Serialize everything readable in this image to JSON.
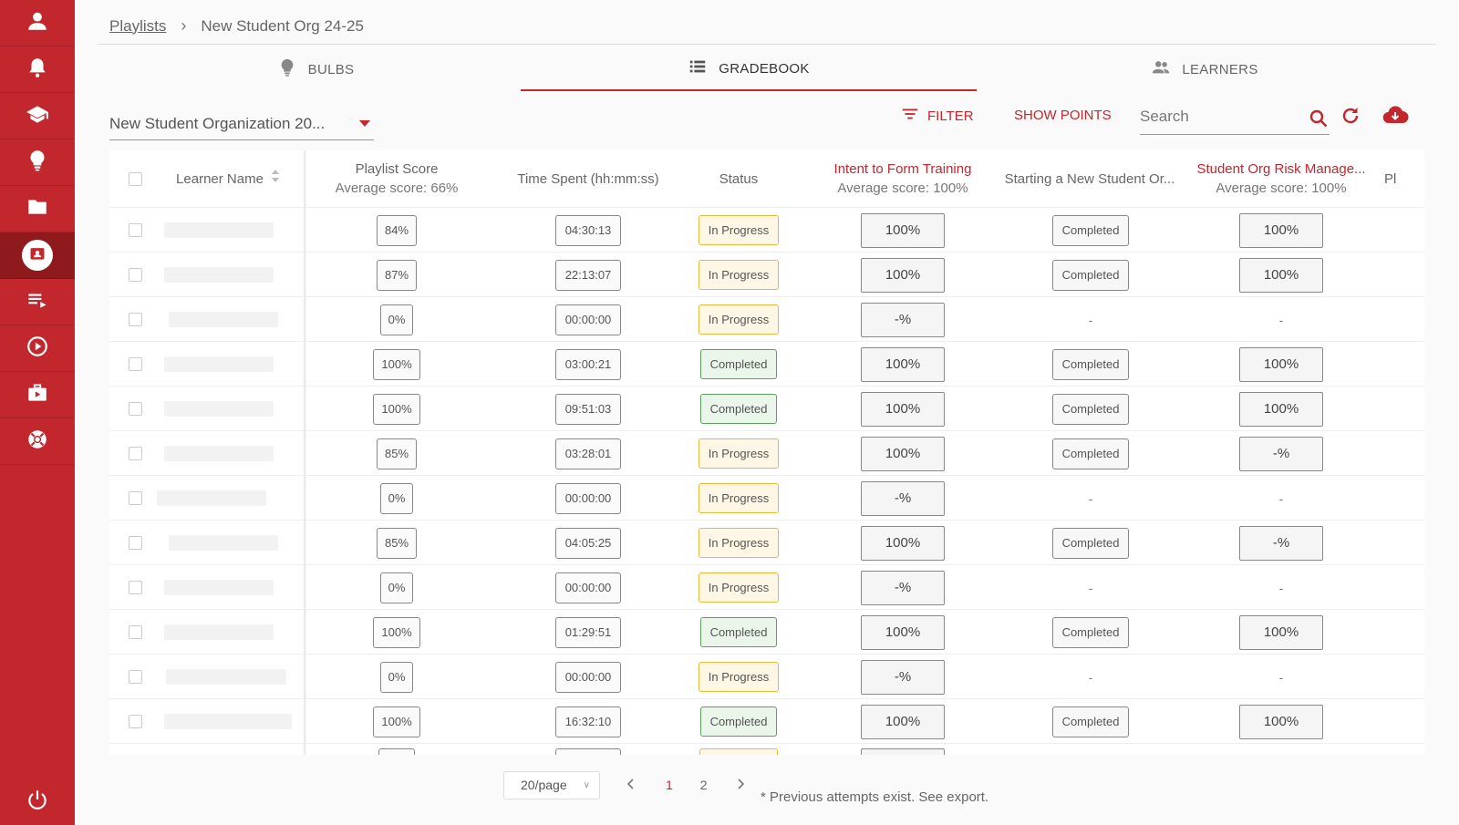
{
  "sidebar": {
    "items": [
      {
        "icon": "user-icon"
      },
      {
        "icon": "bell-icon"
      },
      {
        "icon": "graduation-cap-icon"
      },
      {
        "icon": "lightbulb-icon"
      },
      {
        "icon": "folder-icon"
      },
      {
        "icon": "gradebook-contact-icon",
        "active": true
      },
      {
        "icon": "playlist-icon"
      },
      {
        "icon": "play-circle-icon"
      },
      {
        "icon": "media-briefcase-icon"
      },
      {
        "icon": "support-lifebuoy-icon"
      }
    ],
    "bottom_icon": "power-icon",
    "color": "#c1272d",
    "active_color": "#8e1a1e"
  },
  "breadcrumb": {
    "link": "Playlists",
    "separator": "›",
    "current": "New Student Org 24-25"
  },
  "tabs": [
    {
      "label": "BULBS",
      "icon": "lightbulb-icon"
    },
    {
      "label": "GRADEBOOK",
      "icon": "list-icon",
      "active": true
    },
    {
      "label": "LEARNERS",
      "icon": "people-icon"
    }
  ],
  "toolbar": {
    "org_select": "New Student Organization 20...",
    "filter_label": "FILTER",
    "show_points_label": "SHOW POINTS",
    "search_placeholder": "Search"
  },
  "table": {
    "headers": {
      "name": "Learner Name",
      "score_title": "Playlist Score",
      "score_avg": "Average score: 66%",
      "time": "Time Spent (hh:mm:ss)",
      "status": "Status",
      "intent_title": "Intent to Form Training",
      "intent_avg": "Average score: 100%",
      "starting": "Starting a New Student Or...",
      "risk_title": "Student Org Risk Manage...",
      "risk_avg": "Average score: 100%",
      "extra": "Pl"
    },
    "rows": [
      {
        "score": "84%",
        "time": "04:30:13",
        "status": "In Progress",
        "intent": "100%",
        "starting": "Completed",
        "risk": "100%"
      },
      {
        "score": "87%",
        "time": "22:13:07",
        "status": "In Progress",
        "intent": "100%",
        "starting": "Completed",
        "risk": "100%"
      },
      {
        "score": "0%",
        "time": "00:00:00",
        "status": "In Progress",
        "intent": "-%",
        "starting": "-",
        "risk": "-"
      },
      {
        "score": "100%",
        "time": "03:00:21",
        "status": "Completed",
        "intent": "100%",
        "starting": "Completed",
        "risk": "100%"
      },
      {
        "score": "100%",
        "time": "09:51:03",
        "status": "Completed",
        "intent": "100%",
        "starting": "Completed",
        "risk": "100%"
      },
      {
        "score": "85%",
        "time": "03:28:01",
        "status": "In Progress",
        "intent": "100%",
        "starting": "Completed",
        "risk": "-%"
      },
      {
        "score": "0%",
        "time": "00:00:00",
        "status": "In Progress",
        "intent": "-%",
        "starting": "-",
        "risk": "-"
      },
      {
        "score": "85%",
        "time": "04:05:25",
        "status": "In Progress",
        "intent": "100%",
        "starting": "Completed",
        "risk": "-%"
      },
      {
        "score": "0%",
        "time": "00:00:00",
        "status": "In Progress",
        "intent": "-%",
        "starting": "-",
        "risk": "-"
      },
      {
        "score": "100%",
        "time": "01:29:51",
        "status": "Completed",
        "intent": "100%",
        "starting": "Completed",
        "risk": "100%"
      },
      {
        "score": "0%",
        "time": "00:00:00",
        "status": "In Progress",
        "intent": "-%",
        "starting": "-",
        "risk": "-"
      },
      {
        "score": "100%",
        "time": "16:32:10",
        "status": "Completed",
        "intent": "100%",
        "starting": "Completed",
        "risk": "100%"
      }
    ]
  },
  "pagination": {
    "page_size": "20/page",
    "pages": [
      "1",
      "2"
    ],
    "current": "1",
    "note": "* Previous attempts exist. See export."
  }
}
